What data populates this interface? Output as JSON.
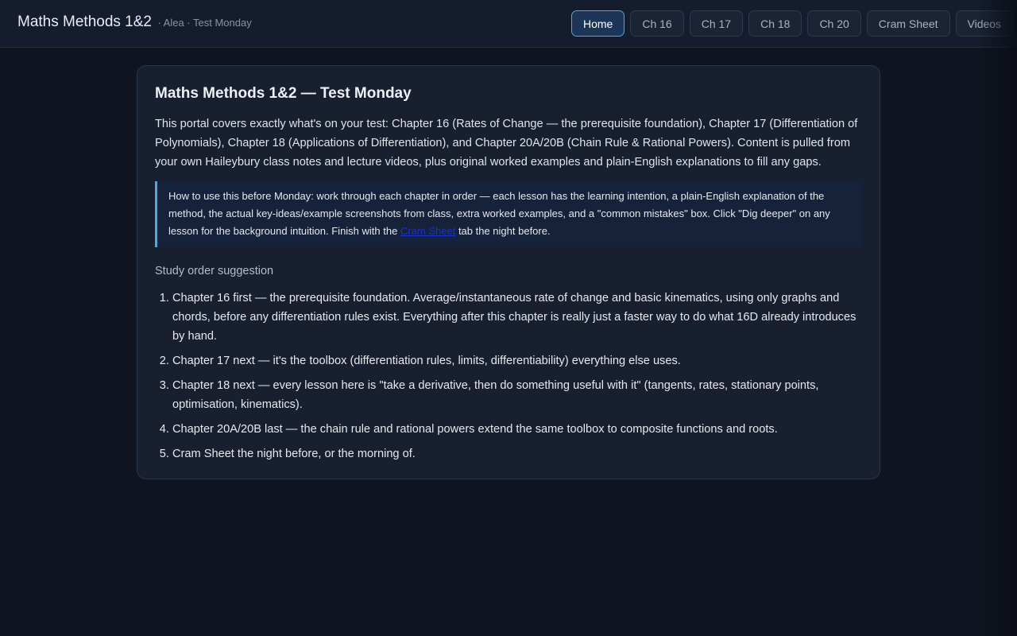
{
  "header": {
    "title": "Maths Methods 1&2",
    "subtitle": "· Alea · Test Monday"
  },
  "nav": {
    "tabs": [
      {
        "label": "Home",
        "active": true
      },
      {
        "label": "Ch 16"
      },
      {
        "label": "Ch 17"
      },
      {
        "label": "Ch 18"
      },
      {
        "label": "Ch 20"
      },
      {
        "label": "Cram Sheet"
      },
      {
        "label": "Videos"
      }
    ]
  },
  "main": {
    "title": "Maths Methods 1&2 — Test Monday",
    "intro": "This portal covers exactly what's on your test: Chapter 16 (Rates of Change — the prerequisite foundation), Chapter 17 (Differentiation of Polynomials), Chapter 18 (Applications of Differentiation), and Chapter 20A/20B (Chain Rule & Rational Powers). Content is pulled from your own Haileybury class notes and lecture videos, plus original worked examples and plain-English explanations to fill any gaps.",
    "callout": {
      "before": "How to use this before Monday: work through each chapter in order — each lesson has the learning intention, a plain-English explanation of the method, the actual key-ideas/example screenshots from class, extra worked examples, and a \"common mistakes\" box. Click \"Dig deeper\" on any lesson for the background intuition. Finish with the ",
      "link": "Cram Sheet",
      "after": " tab the night before."
    },
    "study_order_label": "Study order suggestion",
    "study_order": [
      "Chapter 16 first — the prerequisite foundation. Average/instantaneous rate of change and basic kinematics, using only graphs and chords, before any differentiation rules exist. Everything after this chapter is really just a faster way to do what 16D already introduces by hand.",
      "Chapter 17 next — it's the toolbox (differentiation rules, limits, differentiability) everything else uses.",
      "Chapter 18 next — every lesson here is \"take a derivative, then do something useful with it\" (tangents, rates, stationary points, optimisation, kinematics).",
      "Chapter 20A/20B last — the chain rule and rational powers extend the same toolbox to composite functions and roots.",
      "Cram Sheet the night before, or the morning of."
    ]
  },
  "colors": {
    "accent": "#4aa8e6",
    "background": "#0f1420",
    "card": "#181f2e"
  }
}
